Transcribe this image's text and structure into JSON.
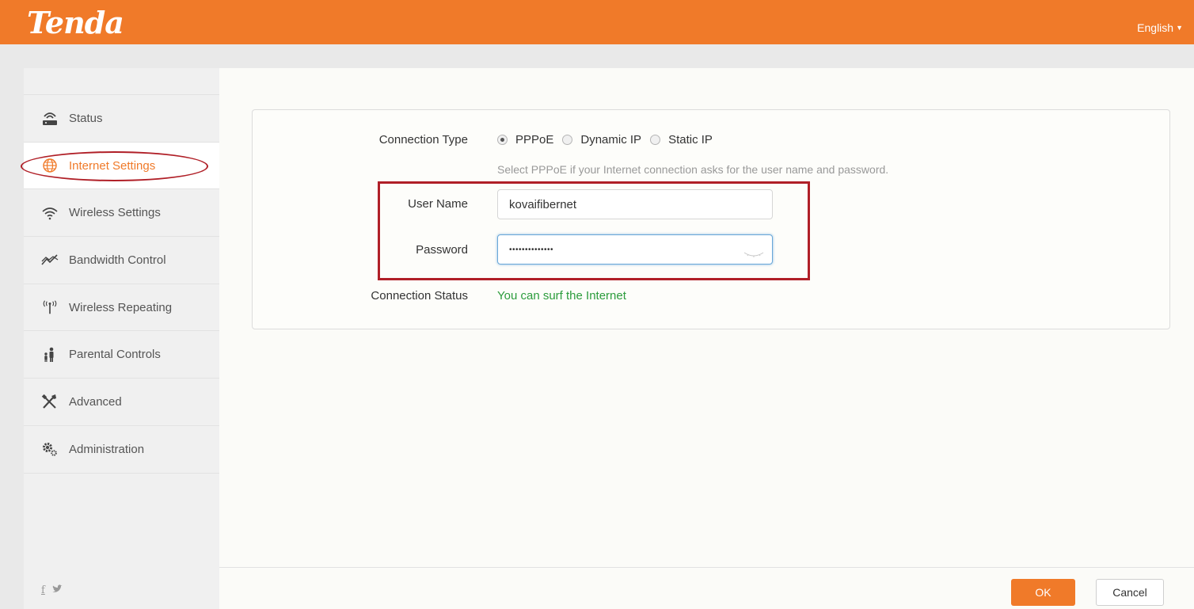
{
  "header": {
    "logo": "Tenda",
    "language": "English"
  },
  "sidebar": {
    "items": [
      {
        "label": "Status",
        "icon": "router-icon"
      },
      {
        "label": "Internet Settings",
        "icon": "globe-icon",
        "active": true
      },
      {
        "label": "Wireless Settings",
        "icon": "wifi-icon"
      },
      {
        "label": "Bandwidth Control",
        "icon": "bandwidth-icon"
      },
      {
        "label": "Wireless Repeating",
        "icon": "antenna-icon"
      },
      {
        "label": "Parental Controls",
        "icon": "parent-child-icon"
      },
      {
        "label": "Advanced",
        "icon": "tools-icon"
      },
      {
        "label": "Administration",
        "icon": "gears-icon"
      }
    ],
    "social": {
      "facebook": "f",
      "twitter": "t"
    }
  },
  "form": {
    "connection_type_label": "Connection Type",
    "options": [
      "PPPoE",
      "Dynamic IP",
      "Static IP"
    ],
    "selected_option": "PPPoE",
    "hint": "Select PPPoE if your Internet connection asks for the user name and password.",
    "username_label": "User Name",
    "username_value": "kovaifibernet",
    "password_label": "Password",
    "password_value": "••••••••••••••",
    "connection_status_label": "Connection Status",
    "connection_status_value": "You can surf the Internet"
  },
  "footer": {
    "ok_label": "OK",
    "cancel_label": "Cancel"
  },
  "colors": {
    "brand": "#f07a29",
    "annotation": "#b01f27",
    "status_ok": "#2c9c3c"
  }
}
